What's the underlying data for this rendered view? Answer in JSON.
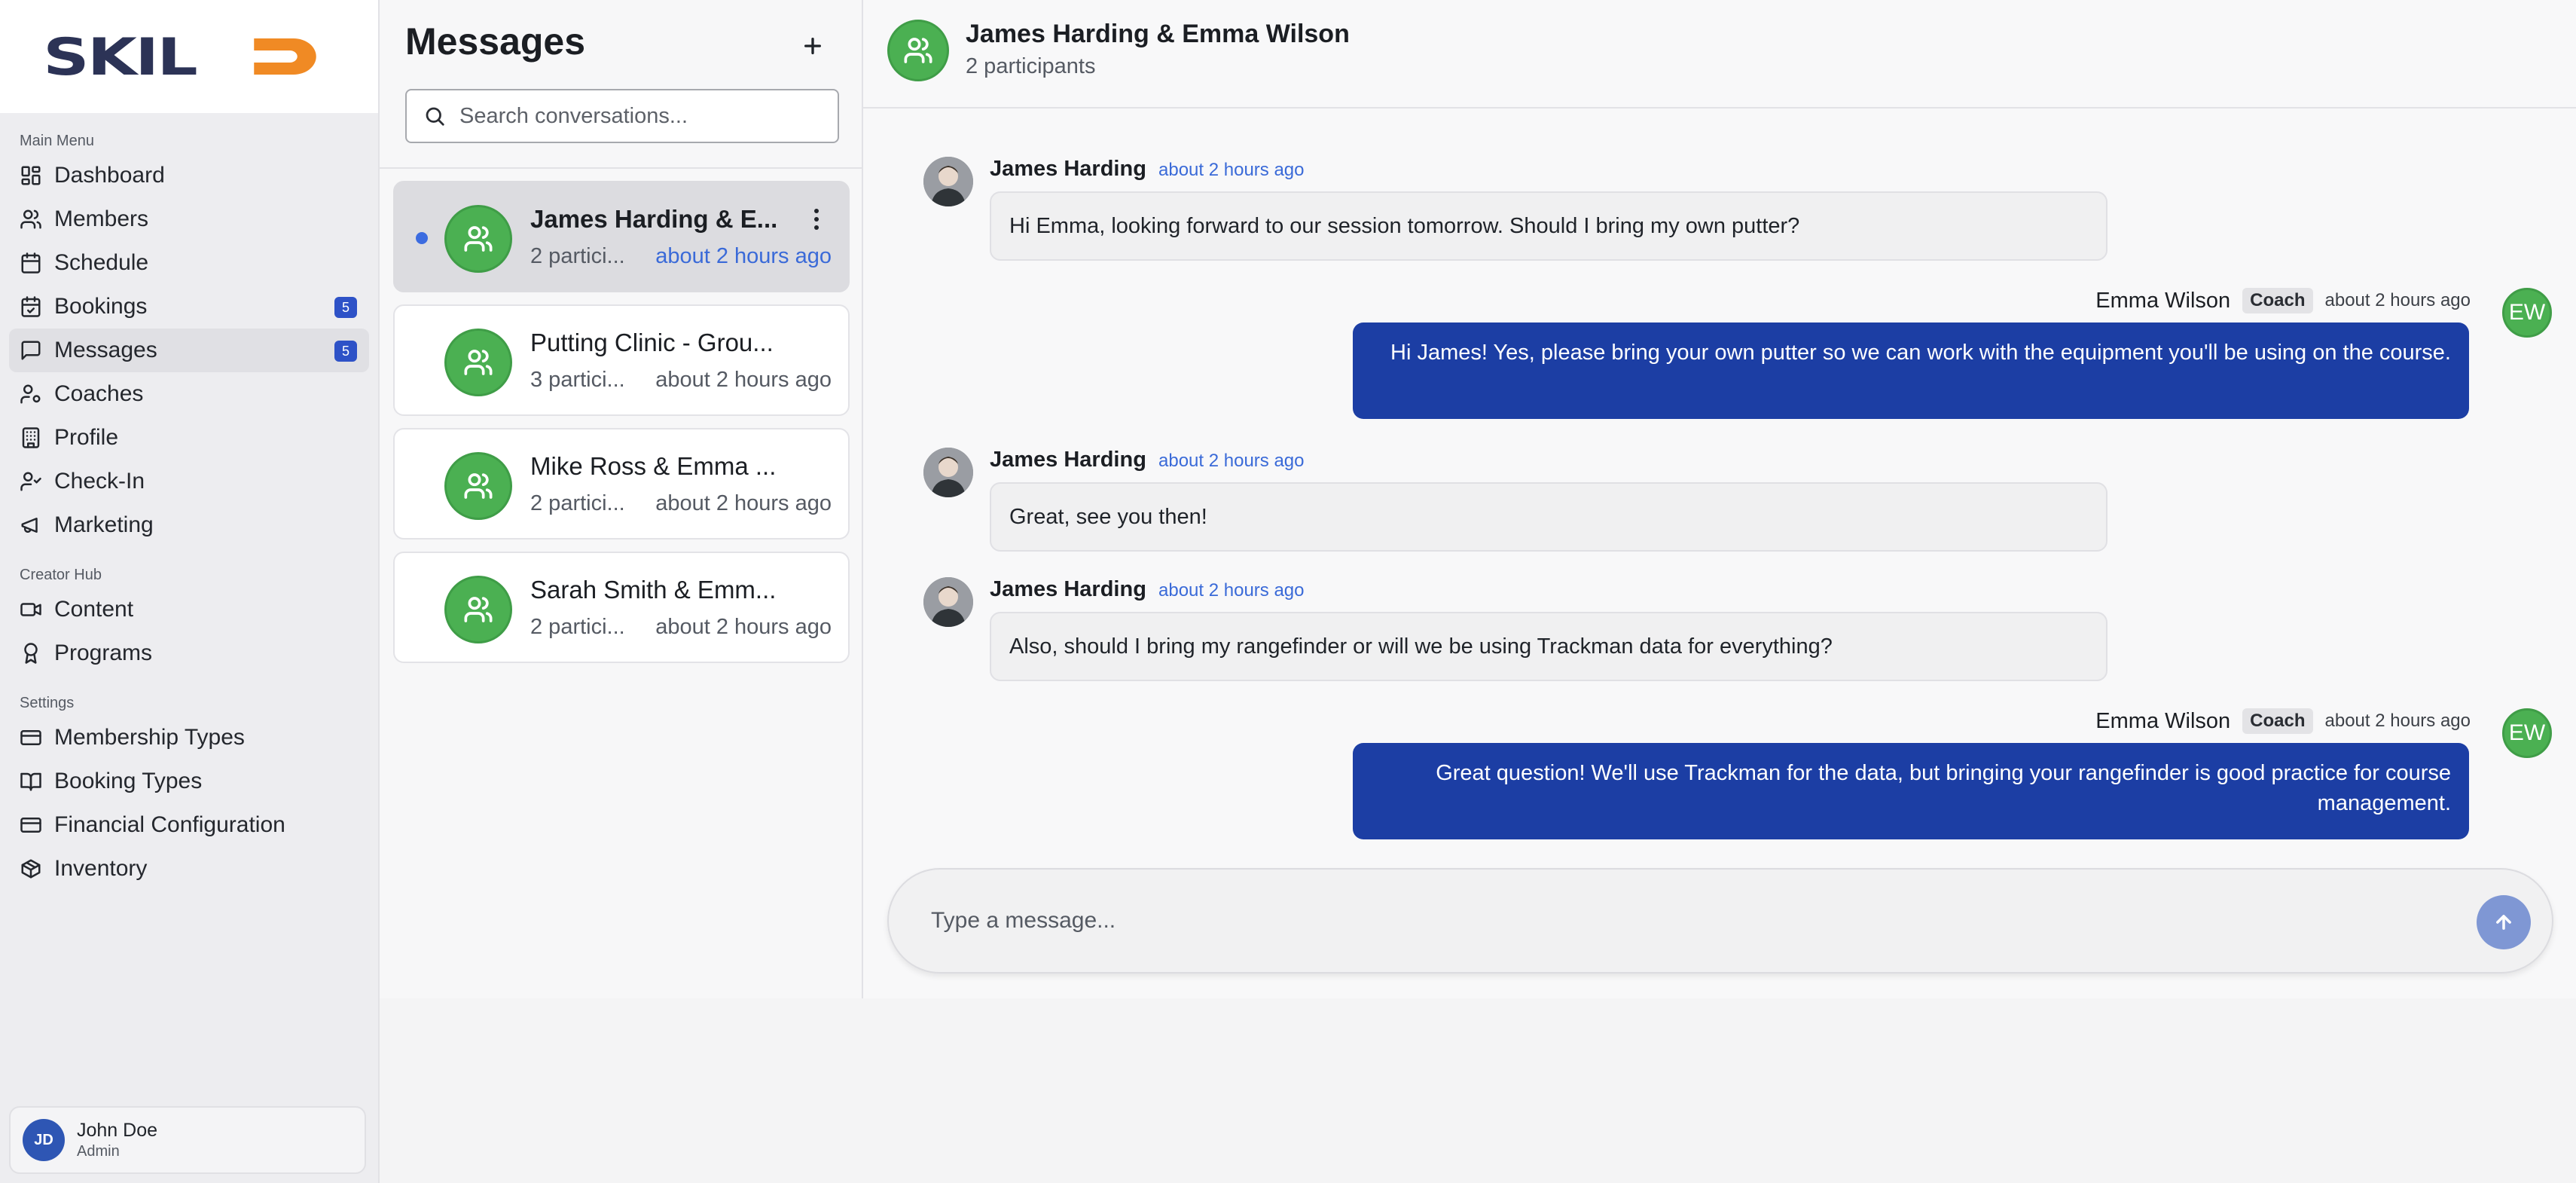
{
  "app": {
    "logo_text": "SKILD"
  },
  "sidebar": {
    "sections": {
      "main": "Main Menu",
      "creator": "Creator Hub",
      "settings": "Settings"
    },
    "items": [
      {
        "label": "Dashboard",
        "icon": "dashboard-icon"
      },
      {
        "label": "Members",
        "icon": "users-icon"
      },
      {
        "label": "Schedule",
        "icon": "calendar-icon"
      },
      {
        "label": "Bookings",
        "icon": "calendar-check-icon",
        "badge": "5"
      },
      {
        "label": "Messages",
        "icon": "message-icon",
        "badge": "5",
        "active": true
      },
      {
        "label": "Coaches",
        "icon": "user-cog-icon"
      },
      {
        "label": "Profile",
        "icon": "building-icon"
      },
      {
        "label": "Check-In",
        "icon": "user-check-icon"
      },
      {
        "label": "Marketing",
        "icon": "megaphone-icon"
      },
      {
        "label": "Content",
        "icon": "video-icon"
      },
      {
        "label": "Programs",
        "icon": "award-icon"
      },
      {
        "label": "Membership Types",
        "icon": "credit-card-icon"
      },
      {
        "label": "Booking Types",
        "icon": "book-open-icon"
      },
      {
        "label": "Financial Configuration",
        "icon": "credit-card-icon"
      },
      {
        "label": "Inventory",
        "icon": "package-icon"
      }
    ],
    "user": {
      "initials": "JD",
      "name": "John Doe",
      "role": "Admin"
    }
  },
  "conversations": {
    "title": "Messages",
    "search_placeholder": "Search conversations...",
    "items": [
      {
        "name": "James Harding & E...",
        "participants": "2 partici...",
        "time": "about 2 hours ago",
        "selected": true,
        "unread": true
      },
      {
        "name": "Putting Clinic - Grou...",
        "participants": "3 partici...",
        "time": "about 2 hours ago"
      },
      {
        "name": "Mike Ross & Emma ...",
        "participants": "2 partici...",
        "time": "about 2 hours ago"
      },
      {
        "name": "Sarah Smith & Emm...",
        "participants": "2 partici...",
        "time": "about 2 hours ago"
      }
    ]
  },
  "chat": {
    "title": "James Harding & Emma Wilson",
    "subtitle": "2 participants",
    "messages": [
      {
        "sender": "James Harding",
        "time": "about 2 hours ago",
        "text": "Hi Emma, looking forward to our session tomorrow. Should I bring my own putter?"
      },
      {
        "sender": "Emma Wilson",
        "badge": "Coach",
        "initials": "EW",
        "time": "about 2 hours ago",
        "text": "Hi James! Yes, please bring your own putter so we can work with the equipment you'll be using on the course."
      },
      {
        "sender": "James Harding",
        "time": "about 2 hours ago",
        "text": "Great, see you then!"
      },
      {
        "sender": "James Harding",
        "time": "about 2 hours ago",
        "text": "Also, should I bring my rangefinder or will we be using Trackman data for everything?"
      },
      {
        "sender": "Emma Wilson",
        "badge": "Coach",
        "initials": "EW",
        "time": "about 2 hours ago",
        "text": "Great question! We'll use Trackman for the data, but bringing your rangefinder is good practice for course management."
      }
    ],
    "composer_placeholder": "Type a message..."
  },
  "colors": {
    "accent_blue": "#1c3ea4",
    "badge_blue": "#2e52c7",
    "avatar_green": "#4bb052",
    "logo_navy": "#2c3356",
    "logo_orange": "#f08a24"
  }
}
